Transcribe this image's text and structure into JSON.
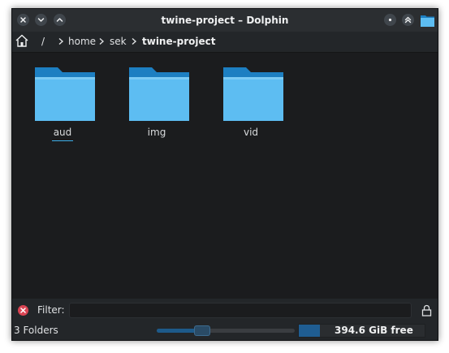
{
  "window": {
    "title": "twine-project – Dolphin"
  },
  "titlebar": {
    "buttons": [
      "close-icon",
      "minimize-icon",
      "maximize-icon",
      "on-all-desktops-icon",
      "keep-above-icon"
    ],
    "app_icon": "folder-icon"
  },
  "breadcrumb": {
    "home_icon": "home-icon",
    "items": [
      {
        "label": "/"
      },
      {
        "label": "home"
      },
      {
        "label": "sek"
      },
      {
        "label": "twine-project"
      }
    ]
  },
  "files": [
    {
      "name": "aud",
      "icon": "folder-icon"
    },
    {
      "name": "img",
      "icon": "folder-icon"
    },
    {
      "name": "vid",
      "icon": "folder-icon"
    }
  ],
  "filter": {
    "label": "Filter:",
    "value": "",
    "placeholder": ""
  },
  "statusbar": {
    "summary": "3 Folders",
    "zoom_fraction": 0.33,
    "free_space": "394.6 GiB free",
    "used_fraction": 0.17
  },
  "colors": {
    "window_bg": "#232629",
    "content_bg": "#1b1c1e",
    "accent": "#3daee9",
    "folder_front": "#5dbdf2",
    "folder_back": "#1d7fc2",
    "close_red": "#da4453"
  }
}
